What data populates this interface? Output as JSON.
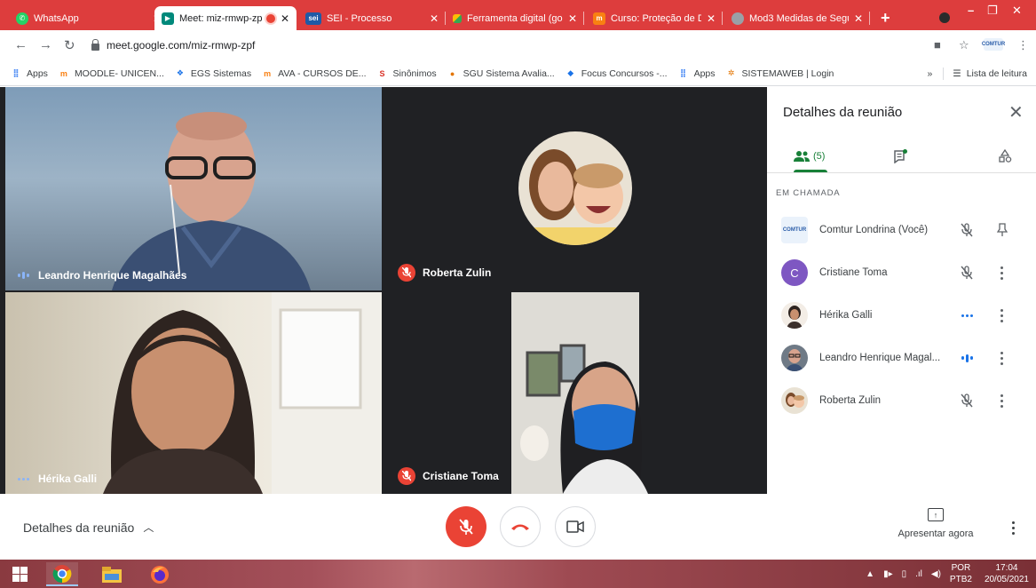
{
  "browser": {
    "tabs": [
      {
        "title": "WhatsApp",
        "favicon": "whatsapp-icon",
        "color": "#25d366",
        "active": false
      },
      {
        "title": "Meet: miz-rmwp-zp",
        "favicon": "meet-icon",
        "color": "#00897b",
        "active": true
      },
      {
        "title": "SEI - Processo",
        "favicon": "sei-icon",
        "color": "#1f5aa6",
        "active": false
      },
      {
        "title": "Ferramenta digital (goo",
        "favicon": "google-icon",
        "color": "#fbbc05",
        "active": false
      },
      {
        "title": "Curso: Proteção de Dad",
        "favicon": "moodle-icon",
        "color": "#f98012",
        "active": false
      },
      {
        "title": "Mod3 Medidas de Segu",
        "favicon": "globe-icon",
        "color": "#9aa0a6",
        "active": false
      }
    ],
    "url": "meet.google.com/miz-rmwp-zpf",
    "bookmarks": [
      {
        "label": "Apps",
        "icon": "apps-grid-icon"
      },
      {
        "label": "MOODLE- UNICEN...",
        "icon": "moodle-icon"
      },
      {
        "label": "EGS Sistemas",
        "icon": "egs-icon"
      },
      {
        "label": "AVA - CURSOS DE...",
        "icon": "moodle-icon"
      },
      {
        "label": "Sinônimos",
        "icon": "sinonimos-icon"
      },
      {
        "label": "SGU Sistema Avalia...",
        "icon": "sgu-icon"
      },
      {
        "label": "Focus Concursos -...",
        "icon": "focus-icon"
      },
      {
        "label": "Apps",
        "icon": "apps-grid-icon"
      },
      {
        "label": "SISTEMAWEB | Login",
        "icon": "sistemaweb-icon"
      }
    ],
    "reading_list": "Lista de leitura",
    "avatar_text": "COMTUR"
  },
  "meeting": {
    "tiles": [
      {
        "name": "Leandro Henrique Magalhães",
        "status": "speaking"
      },
      {
        "name": "Roberta Zulin",
        "status": "muted"
      },
      {
        "name": "Hérika Galli",
        "status": "idle"
      },
      {
        "name": "Cristiane Toma",
        "status": "muted"
      }
    ]
  },
  "panel": {
    "title": "Detalhes da reunião",
    "people_count": "(5)",
    "section_label": "EM CHAMADA",
    "participants": [
      {
        "name": "Comtur Londrina (Você)",
        "avatar": "COMTUR",
        "status": "muted",
        "action": "pin"
      },
      {
        "name": "Cristiane Toma",
        "avatar": "C",
        "status": "muted",
        "action": "more"
      },
      {
        "name": "Hérika Galli",
        "avatar": "",
        "status": "idle",
        "action": "more"
      },
      {
        "name": "Leandro Henrique Magal...",
        "avatar": "",
        "status": "speaking",
        "action": "more"
      },
      {
        "name": "Roberta Zulin",
        "avatar": "",
        "status": "muted",
        "action": "more"
      }
    ]
  },
  "bottombar": {
    "details_label": "Detalhes da reunião",
    "present_label": "Apresentar agora"
  },
  "taskbar": {
    "lang_top": "POR",
    "lang_bottom": "PTB2",
    "time": "17:04",
    "date": "20/05/2021"
  },
  "colors": {
    "tabstrip": "#dd3d3d",
    "meet_red": "#ea4335",
    "meet_green": "#188038",
    "speaking_blue": "#8ab4f8",
    "stage_bg": "#202124",
    "avatar_purple": "#7e57c2"
  }
}
